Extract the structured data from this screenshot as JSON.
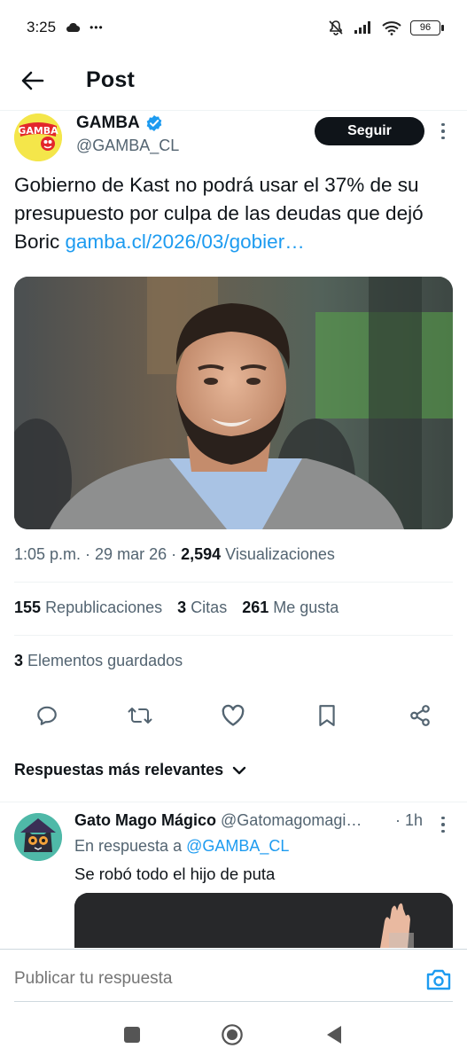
{
  "status_bar": {
    "time": "3:25",
    "extra": "•••",
    "battery": "96",
    "icons": [
      "cloud-icon",
      "bell-off-icon",
      "signal-icon",
      "wifi-icon",
      "battery-icon"
    ]
  },
  "header": {
    "title": "Post",
    "back_icon": "arrow-left-icon"
  },
  "author": {
    "name": "GAMBA",
    "handle": "@GAMBA_CL",
    "verified": true,
    "avatar_logo_text": "GAMBA",
    "follow_label": "Seguir"
  },
  "tweet": {
    "text": "Gobierno de Kast no podrá usar el 37% de su presupuesto por culpa de las deudas que dejó Boric ",
    "link": "gamba.cl/2026/03/gobier…",
    "time": "1:05 p.m.",
    "date": "29 mar 26",
    "views_count": "2,594",
    "views_label": "Visualizaciones",
    "separator": " · "
  },
  "stats": {
    "reposts_count": "155",
    "reposts_label": "Republicaciones",
    "quotes_count": "3",
    "quotes_label": "Citas",
    "likes_count": "261",
    "likes_label": "Me gusta",
    "bookmarks_count": "3",
    "bookmarks_label": "Elementos guardados"
  },
  "actions": [
    "reply-icon",
    "repost-icon",
    "like-icon",
    "bookmark-icon",
    "share-icon"
  ],
  "replies_sort": {
    "label": "Respuestas más relevantes"
  },
  "reply": {
    "name": "Gato Mago Mágico",
    "handle": "@Gatomagomagi…",
    "time": "· 1h",
    "in_reply_prefix": "En respuesta a ",
    "in_reply_to": "@GAMBA_CL",
    "text": "Se robó todo el hijo de puta"
  },
  "compose": {
    "placeholder": "Publicar tu respuesta"
  },
  "colors": {
    "accent": "#1d9bf0",
    "text": "#0f1419",
    "secondary": "#536471",
    "verified": "#1d9bf0"
  }
}
